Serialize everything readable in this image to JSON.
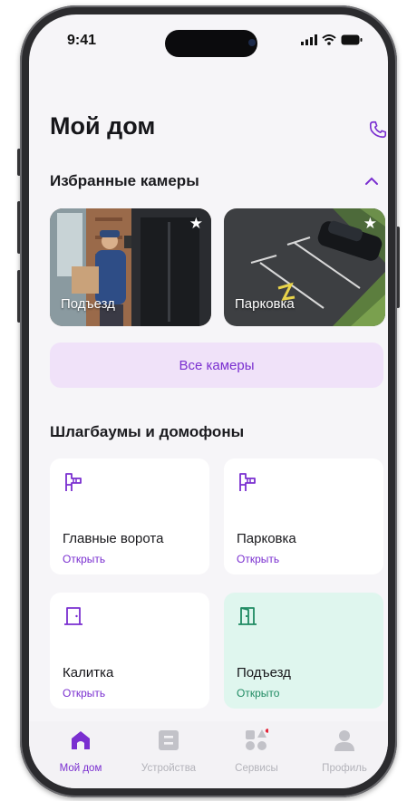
{
  "status": {
    "time": "9:41"
  },
  "header": {
    "title": "Мой дом"
  },
  "favorites": {
    "title": "Избранные камеры",
    "cameras": [
      {
        "label": "Подъезд"
      },
      {
        "label": "Парковка"
      }
    ],
    "all_button": "Все камеры"
  },
  "barriers": {
    "title": "Шлагбаумы и домофоны",
    "items": [
      {
        "name": "Главные ворота",
        "action": "Открыть",
        "icon": "barrier-icon"
      },
      {
        "name": "Парковка",
        "action": "Открыть",
        "icon": "barrier-icon"
      },
      {
        "name": "Калитка",
        "action": "Открыть",
        "icon": "door-icon"
      },
      {
        "name": "Подъезд",
        "action": "Открыто",
        "icon": "door-open-icon"
      }
    ]
  },
  "tabbar": {
    "items": [
      {
        "label": "Мой дом",
        "icon": "home-icon"
      },
      {
        "label": "Устройства",
        "icon": "devices-icon"
      },
      {
        "label": "Сервисы",
        "icon": "services-icon"
      },
      {
        "label": "Профиль",
        "icon": "profile-icon"
      }
    ]
  },
  "colors": {
    "accent": "#7a2fd0",
    "open": "#1f8a62",
    "open_bg": "#dff6ee",
    "button_bg": "#f0e2f9"
  }
}
